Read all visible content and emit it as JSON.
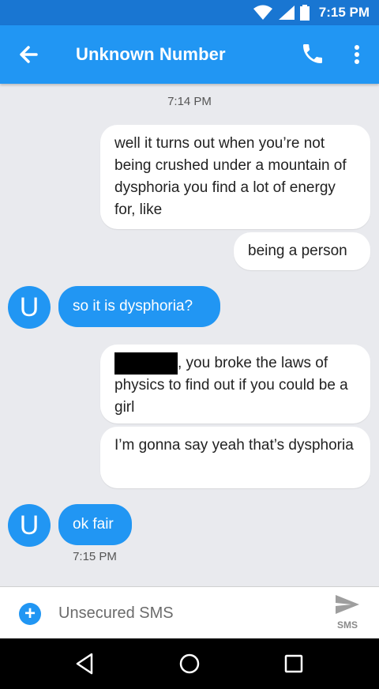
{
  "status_bar": {
    "time": "7:15 PM"
  },
  "app_bar": {
    "title": "Unknown Number"
  },
  "conversation": {
    "timestamp_top": "7:14 PM",
    "messages": [
      {
        "direction": "outgoing",
        "text": "well it turns out when you’re not being crushed under a mountain of dysphoria you find a lot of energy for, like"
      },
      {
        "direction": "outgoing",
        "text": "being a person"
      },
      {
        "direction": "incoming",
        "avatar_letter": "U",
        "text": "so it is dysphoria?"
      },
      {
        "direction": "outgoing",
        "redacted": true,
        "text": ", you broke the laws of physics to find out if you could be a girl"
      },
      {
        "direction": "outgoing",
        "text": "I’m gonna say yeah that’s dysphoria"
      },
      {
        "direction": "incoming",
        "avatar_letter": "U",
        "text": "ok fair"
      }
    ],
    "timestamp_bottom": "7:15 PM"
  },
  "composer": {
    "placeholder": "Unsecured SMS",
    "send_label": "SMS"
  },
  "colors": {
    "primary": "#2196f3",
    "status_bar": "#1976d2",
    "background": "#e9eaee"
  },
  "icons": [
    "wifi-icon",
    "signal-icon",
    "battery-icon",
    "back-arrow-icon",
    "phone-icon",
    "more-vert-icon",
    "add-icon",
    "send-icon",
    "nav-back-icon",
    "nav-home-icon",
    "nav-recents-icon"
  ]
}
